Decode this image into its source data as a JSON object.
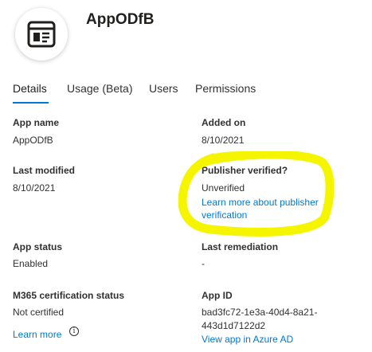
{
  "app": {
    "name": "AppODfB",
    "icon": "app-form-icon"
  },
  "tabs": [
    {
      "label": "Details",
      "active": true
    },
    {
      "label": "Usage (Beta)",
      "active": false
    },
    {
      "label": "Users",
      "active": false
    },
    {
      "label": "Permissions",
      "active": false
    }
  ],
  "details": {
    "app_name": {
      "label": "App name",
      "value": "AppODfB"
    },
    "added_on": {
      "label": "Added on",
      "value": "8/10/2021"
    },
    "last_modified": {
      "label": "Last modified",
      "value": "8/10/2021"
    },
    "publisher_verified": {
      "label": "Publisher verified?",
      "value": "Unverified",
      "link_line1": "Learn more about publisher",
      "link_line2": "verification"
    },
    "app_status": {
      "label": "App status",
      "value": "Enabled"
    },
    "last_remediation": {
      "label": "Last remediation",
      "value": "-"
    },
    "m365_certification": {
      "label": "M365 certification status",
      "value": "Not certified",
      "link": "Learn more",
      "info_icon": "info-icon"
    },
    "app_id": {
      "label": "App ID",
      "value_line1": "bad3fc72-1e3a-40d4-8a21-",
      "value_line2": "443d1d7122d2",
      "link": "View app in Azure AD"
    }
  },
  "colors": {
    "accent": "#0078d4",
    "highlight": "#f5f500",
    "text": "#323130"
  }
}
